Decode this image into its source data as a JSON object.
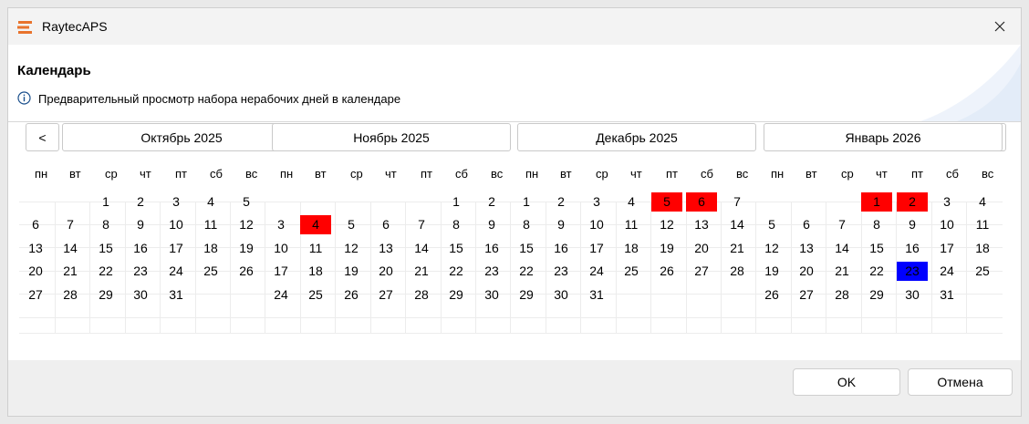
{
  "window": {
    "title": "RaytecAPS"
  },
  "header": {
    "title": "Календарь",
    "description": "Предварительный просмотр набора нерабочих дней в календаре"
  },
  "nav": {
    "prev": "<",
    "next": ">"
  },
  "weekdays": [
    "пн",
    "вт",
    "ср",
    "чт",
    "пт",
    "сб",
    "вс"
  ],
  "months": [
    {
      "name": "Октябрь 2025",
      "weeks": [
        [
          "",
          "",
          "1",
          "2",
          "3",
          "4",
          "5"
        ],
        [
          "6",
          "7",
          "8",
          "9",
          "10",
          "11",
          "12"
        ],
        [
          "13",
          "14",
          "15",
          "16",
          "17",
          "18",
          "19"
        ],
        [
          "20",
          "21",
          "22",
          "23",
          "24",
          "25",
          "26"
        ],
        [
          "27",
          "28",
          "29",
          "30",
          "31",
          "",
          ""
        ]
      ]
    },
    {
      "name": "Ноябрь 2025",
      "weeks": [
        [
          "",
          "",
          "",
          "",
          "",
          "1",
          "2"
        ],
        [
          "3",
          "4",
          "5",
          "6",
          "7",
          "8",
          "9"
        ],
        [
          "10",
          "11",
          "12",
          "13",
          "14",
          "15",
          "16"
        ],
        [
          "17",
          "18",
          "19",
          "20",
          "21",
          "22",
          "23"
        ],
        [
          "24",
          "25",
          "26",
          "27",
          "28",
          "29",
          "30"
        ]
      ]
    },
    {
      "name": "Декабрь 2025",
      "weeks": [
        [
          "1",
          "2",
          "3",
          "4",
          "5",
          "6",
          "7"
        ],
        [
          "8",
          "9",
          "10",
          "11",
          "12",
          "13",
          "14"
        ],
        [
          "15",
          "16",
          "17",
          "18",
          "19",
          "20",
          "21"
        ],
        [
          "22",
          "23",
          "24",
          "25",
          "26",
          "27",
          "28"
        ],
        [
          "29",
          "30",
          "31",
          "",
          "",
          "",
          ""
        ]
      ]
    },
    {
      "name": "Январь 2026",
      "weeks": [
        [
          "",
          "",
          "",
          "1",
          "2",
          "3",
          "4"
        ],
        [
          "5",
          "6",
          "7",
          "8",
          "9",
          "10",
          "11"
        ],
        [
          "12",
          "13",
          "14",
          "15",
          "16",
          "17",
          "18"
        ],
        [
          "19",
          "20",
          "21",
          "22",
          "23",
          "24",
          "25"
        ],
        [
          "26",
          "27",
          "28",
          "29",
          "30",
          "31",
          ""
        ]
      ]
    }
  ],
  "marked_days": [
    {
      "month": 1,
      "day": "4",
      "color": "#ff0000"
    },
    {
      "month": 2,
      "day": "5",
      "color": "#ff0000"
    },
    {
      "month": 2,
      "day": "6",
      "color": "#ff0000"
    },
    {
      "month": 3,
      "day": "1",
      "color": "#ff0000"
    },
    {
      "month": 3,
      "day": "2",
      "color": "#ff0000"
    },
    {
      "month": 3,
      "day": "23",
      "color": "#0000ff"
    }
  ],
  "buttons": {
    "ok": "OK",
    "cancel": "Отмена"
  },
  "colors": {
    "holiday": "#ff0000",
    "selected": "#0000ff",
    "logo": "#e8732c"
  }
}
